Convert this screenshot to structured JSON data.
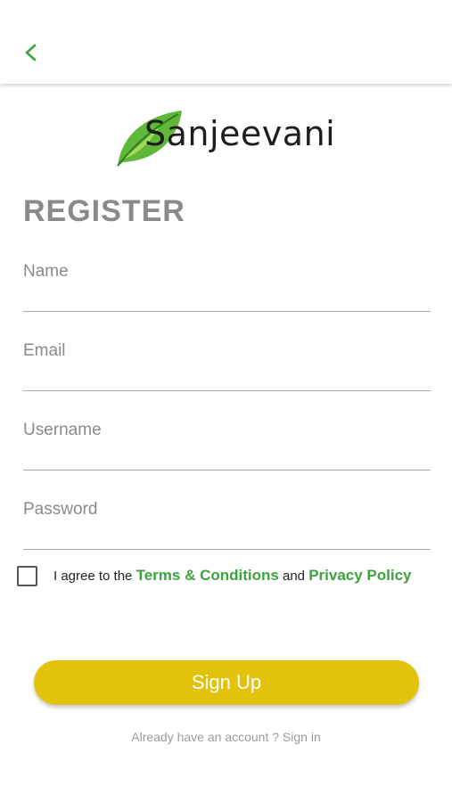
{
  "header": {
    "back_icon": "chevron-left-icon"
  },
  "logo": {
    "text": "Sanjeevani",
    "icon": "leaf-icon"
  },
  "form": {
    "title": "REGISTER",
    "fields": [
      {
        "placeholder": "Name",
        "value": ""
      },
      {
        "placeholder": "Email",
        "value": ""
      },
      {
        "placeholder": "Username",
        "value": ""
      },
      {
        "placeholder": "Password",
        "value": ""
      }
    ],
    "agreement": {
      "checked": false,
      "prefix": "I agree to the ",
      "terms_link": "Terms & Conditions",
      "conjunction": " and ",
      "privacy_link": "Privacy Policy"
    },
    "submit_label": "Sign Up",
    "signin_text": "Already have an account ? Sign in"
  },
  "colors": {
    "accent_green": "#3ea33c",
    "button_yellow": "#e2c20b",
    "title_gray": "#8a8a8a"
  }
}
